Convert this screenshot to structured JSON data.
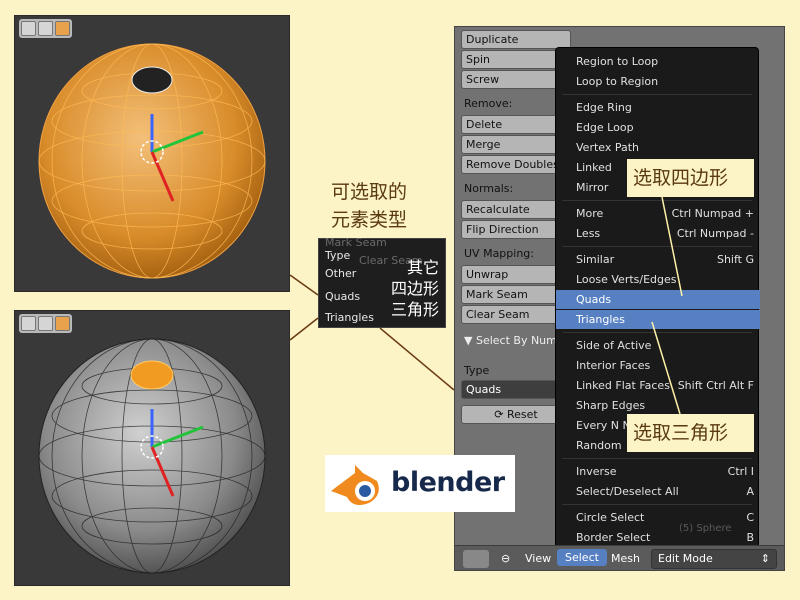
{
  "captions": {
    "main_line1": "可选取的",
    "main_line2": "元素类型"
  },
  "mini_panel": {
    "ghost_top": "Mark Seam",
    "ghost_second": "Clear Seam",
    "type_label": "Type",
    "options": [
      "Other",
      "Quads",
      "Triangles"
    ],
    "cn_labels": [
      "其它",
      "四边形",
      "三角形"
    ]
  },
  "tool_panel": {
    "buttons_top": [
      "Duplicate",
      "Spin",
      "Screw"
    ],
    "remove_label": "Remove:",
    "remove_buttons": [
      "Delete",
      "Merge",
      "Remove Doubles"
    ],
    "normals_label": "Normals:",
    "normals_buttons": [
      "Recalculate",
      "Flip Direction"
    ],
    "uv_label": "UV Mapping:",
    "uv_buttons": [
      "Unwrap",
      "Mark Seam",
      "Clear Seam"
    ],
    "select_by_label": "Select By Number",
    "type_label": "Type",
    "type_value": "Quads",
    "reset_label": "Reset"
  },
  "menu": {
    "items": [
      {
        "label": "Region to Loop",
        "shortcut": ""
      },
      {
        "label": "Loop to Region",
        "shortcut": ""
      },
      {
        "label": "Edge Ring",
        "shortcut": ""
      },
      {
        "label": "Edge Loop",
        "shortcut": ""
      },
      {
        "label": "Vertex Path",
        "shortcut": ""
      },
      {
        "label": "Linked",
        "shortcut": ""
      },
      {
        "label": "Mirror",
        "shortcut": ""
      },
      {
        "label": "More",
        "shortcut": "Ctrl Numpad +"
      },
      {
        "label": "Less",
        "shortcut": "Ctrl Numpad -"
      },
      {
        "label": "Similar",
        "shortcut": "Shift G"
      },
      {
        "label": "Loose Verts/Edges",
        "shortcut": ""
      },
      {
        "label": "Quads",
        "shortcut": ""
      },
      {
        "label": "Triangles",
        "shortcut": ""
      },
      {
        "label": "Side of Active",
        "shortcut": ""
      },
      {
        "label": "Interior Faces",
        "shortcut": ""
      },
      {
        "label": "Linked Flat Faces",
        "shortcut": "Shift Ctrl Alt F"
      },
      {
        "label": "Sharp Edges",
        "shortcut": ""
      },
      {
        "label": "Every N N",
        "shortcut": ""
      },
      {
        "label": "Random",
        "shortcut": ""
      },
      {
        "label": "Inverse",
        "shortcut": "Ctrl I"
      },
      {
        "label": "Select/Deselect All",
        "shortcut": "A"
      },
      {
        "label": "Circle Select",
        "shortcut": "C"
      },
      {
        "label": "Border Select",
        "shortcut": "B"
      }
    ],
    "highlighted": [
      "Quads",
      "Triangles"
    ]
  },
  "bottom_bar": {
    "view": "View",
    "select": "Select",
    "mesh": "Mesh",
    "mode": "Edit Mode",
    "object_name": "(5) Sphere"
  },
  "callouts": {
    "quads": "选取四边形",
    "triangles": "选取三角形"
  },
  "logo": {
    "word": "blender"
  },
  "colors": {
    "background": "#fcf3c7",
    "selection_orange": "#e79a2c",
    "menu_highlight": "#5680c2",
    "viewport": "#393939"
  }
}
